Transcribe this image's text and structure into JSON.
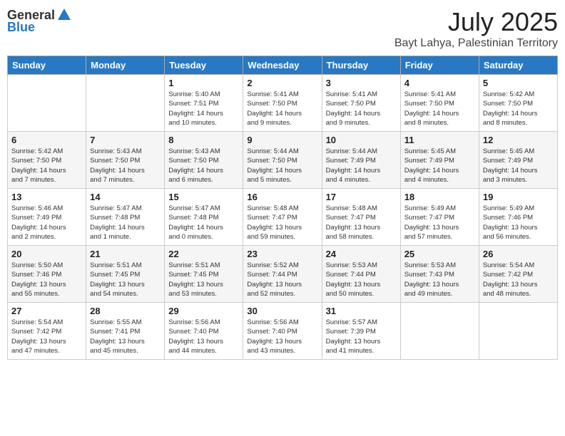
{
  "logo": {
    "general": "General",
    "blue": "Blue"
  },
  "header": {
    "month": "July 2025",
    "location": "Bayt Lahya, Palestinian Territory"
  },
  "days_of_week": [
    "Sunday",
    "Monday",
    "Tuesday",
    "Wednesday",
    "Thursday",
    "Friday",
    "Saturday"
  ],
  "weeks": [
    [
      {
        "day": "",
        "info": ""
      },
      {
        "day": "",
        "info": ""
      },
      {
        "day": "1",
        "info": "Sunrise: 5:40 AM\nSunset: 7:51 PM\nDaylight: 14 hours\nand 10 minutes."
      },
      {
        "day": "2",
        "info": "Sunrise: 5:41 AM\nSunset: 7:50 PM\nDaylight: 14 hours\nand 9 minutes."
      },
      {
        "day": "3",
        "info": "Sunrise: 5:41 AM\nSunset: 7:50 PM\nDaylight: 14 hours\nand 9 minutes."
      },
      {
        "day": "4",
        "info": "Sunrise: 5:41 AM\nSunset: 7:50 PM\nDaylight: 14 hours\nand 8 minutes."
      },
      {
        "day": "5",
        "info": "Sunrise: 5:42 AM\nSunset: 7:50 PM\nDaylight: 14 hours\nand 8 minutes."
      }
    ],
    [
      {
        "day": "6",
        "info": "Sunrise: 5:42 AM\nSunset: 7:50 PM\nDaylight: 14 hours\nand 7 minutes."
      },
      {
        "day": "7",
        "info": "Sunrise: 5:43 AM\nSunset: 7:50 PM\nDaylight: 14 hours\nand 7 minutes."
      },
      {
        "day": "8",
        "info": "Sunrise: 5:43 AM\nSunset: 7:50 PM\nDaylight: 14 hours\nand 6 minutes."
      },
      {
        "day": "9",
        "info": "Sunrise: 5:44 AM\nSunset: 7:50 PM\nDaylight: 14 hours\nand 5 minutes."
      },
      {
        "day": "10",
        "info": "Sunrise: 5:44 AM\nSunset: 7:49 PM\nDaylight: 14 hours\nand 4 minutes."
      },
      {
        "day": "11",
        "info": "Sunrise: 5:45 AM\nSunset: 7:49 PM\nDaylight: 14 hours\nand 4 minutes."
      },
      {
        "day": "12",
        "info": "Sunrise: 5:45 AM\nSunset: 7:49 PM\nDaylight: 14 hours\nand 3 minutes."
      }
    ],
    [
      {
        "day": "13",
        "info": "Sunrise: 5:46 AM\nSunset: 7:49 PM\nDaylight: 14 hours\nand 2 minutes."
      },
      {
        "day": "14",
        "info": "Sunrise: 5:47 AM\nSunset: 7:48 PM\nDaylight: 14 hours\nand 1 minute."
      },
      {
        "day": "15",
        "info": "Sunrise: 5:47 AM\nSunset: 7:48 PM\nDaylight: 14 hours\nand 0 minutes."
      },
      {
        "day": "16",
        "info": "Sunrise: 5:48 AM\nSunset: 7:47 PM\nDaylight: 13 hours\nand 59 minutes."
      },
      {
        "day": "17",
        "info": "Sunrise: 5:48 AM\nSunset: 7:47 PM\nDaylight: 13 hours\nand 58 minutes."
      },
      {
        "day": "18",
        "info": "Sunrise: 5:49 AM\nSunset: 7:47 PM\nDaylight: 13 hours\nand 57 minutes."
      },
      {
        "day": "19",
        "info": "Sunrise: 5:49 AM\nSunset: 7:46 PM\nDaylight: 13 hours\nand 56 minutes."
      }
    ],
    [
      {
        "day": "20",
        "info": "Sunrise: 5:50 AM\nSunset: 7:46 PM\nDaylight: 13 hours\nand 55 minutes."
      },
      {
        "day": "21",
        "info": "Sunrise: 5:51 AM\nSunset: 7:45 PM\nDaylight: 13 hours\nand 54 minutes."
      },
      {
        "day": "22",
        "info": "Sunrise: 5:51 AM\nSunset: 7:45 PM\nDaylight: 13 hours\nand 53 minutes."
      },
      {
        "day": "23",
        "info": "Sunrise: 5:52 AM\nSunset: 7:44 PM\nDaylight: 13 hours\nand 52 minutes."
      },
      {
        "day": "24",
        "info": "Sunrise: 5:53 AM\nSunset: 7:44 PM\nDaylight: 13 hours\nand 50 minutes."
      },
      {
        "day": "25",
        "info": "Sunrise: 5:53 AM\nSunset: 7:43 PM\nDaylight: 13 hours\nand 49 minutes."
      },
      {
        "day": "26",
        "info": "Sunrise: 5:54 AM\nSunset: 7:42 PM\nDaylight: 13 hours\nand 48 minutes."
      }
    ],
    [
      {
        "day": "27",
        "info": "Sunrise: 5:54 AM\nSunset: 7:42 PM\nDaylight: 13 hours\nand 47 minutes."
      },
      {
        "day": "28",
        "info": "Sunrise: 5:55 AM\nSunset: 7:41 PM\nDaylight: 13 hours\nand 45 minutes."
      },
      {
        "day": "29",
        "info": "Sunrise: 5:56 AM\nSunset: 7:40 PM\nDaylight: 13 hours\nand 44 minutes."
      },
      {
        "day": "30",
        "info": "Sunrise: 5:56 AM\nSunset: 7:40 PM\nDaylight: 13 hours\nand 43 minutes."
      },
      {
        "day": "31",
        "info": "Sunrise: 5:57 AM\nSunset: 7:39 PM\nDaylight: 13 hours\nand 41 minutes."
      },
      {
        "day": "",
        "info": ""
      },
      {
        "day": "",
        "info": ""
      }
    ]
  ]
}
